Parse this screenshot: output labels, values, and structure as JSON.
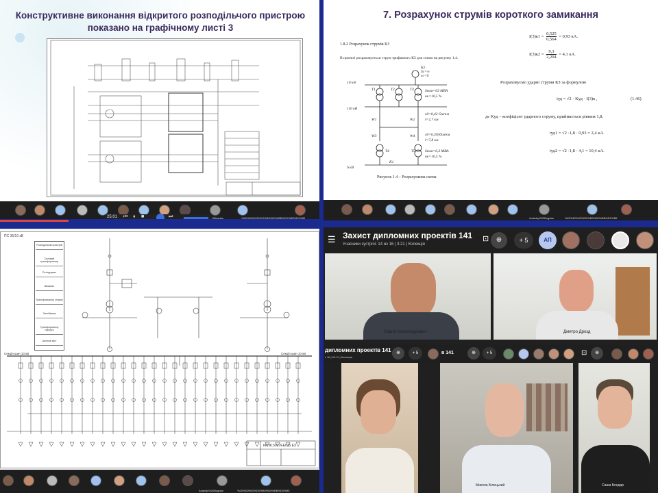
{
  "q1": {
    "title": "Конструктивне виконання відкритого розподільчого пристрою показано на графічному листі 3",
    "video_time": "25:01",
    "bar_text_1": "Anatoliy%20Bogdan",
    "bar_text_2": "%20%D0%92%D0%B0%D0%BB%D0%B5%D1%80"
  },
  "q2": {
    "title": "7. Розрахунок струмів короткого замикання",
    "section": "1.8.2 Розрахунок струмів КЗ",
    "intro": "В проекті розраховується струм трифазного КЗ для схеми на рисунку 1.4.",
    "figure_caption": "Рисунок 1.4 – Розрахункова схема",
    "f1_lhs": "I(3)к1 =",
    "f1_num": "0,525",
    "f1_den": "0,564",
    "f1_res": "= 0,93 кА.",
    "f2_lhs": "I(3)к2 =",
    "f2_num": "9,3",
    "f2_den": "2,204",
    "f2_res": "= 4,1 кА.",
    "shock_text": "Розраховуємо ударні струми КЗ за формулою",
    "shock_formula": "iуд = √2 · Kуд · I(3)к ,",
    "eq_no": "(1.46)",
    "kud_text": "де Kуд – коефіцієнт ударного струму, приймається рівним 1,8.",
    "i1": "iуд1 = √2 ·1,8 · 0,93 = 2,4 кА.",
    "i2": "iуд2 = √2 ·1,8 · 4,1 = 10,4 кА.",
    "labels": {
      "sc": "Sс=∞",
      "xc": "xс=0",
      "kv10": "10 кВ",
      "kv110": "110 кВ",
      "kv6": "6 кВ",
      "t1": "T1",
      "t2": "T2",
      "t3": "T3",
      "t4": "T4",
      "t5": "T5",
      "w1": "W1",
      "w2": "W2",
      "w3": "W3",
      "w4": "W4",
      "s1": "Sном=63 МВА",
      "u1": "uк=10,5 %",
      "x0": "x0=0,42 Ом/км",
      "l1": "l=2,7 км",
      "x02": "x0=0,393Ом/км",
      "l2": "l=7,8 км",
      "s2": "Sном=6,3 МВА",
      "u2": "uк=10,5 %",
      "k1": "K1",
      "k2": "K2"
    },
    "bar_text_1": "Anatoliy%20Bogdan",
    "bar_text_2": "%20%D0%92%D0%B0%D0%BB%D0%B5"
  },
  "q3": {
    "stamp": "КРПК.5017ЕЕ015 ЕЗ",
    "side_title": "ПС 35/10 кВ",
    "table_rows": [
      "Розподільчий пристрій",
      "Силовий трансформатор",
      "Роз'єднувач",
      "Вимикач",
      "Трансформатор струму",
      "Запобіжник",
      "Трансформатор напруги",
      "Шинний міст"
    ],
    "bus_left": "Секція шин 10 кВ",
    "bus_right": "Секція шин 10 кВ",
    "bar_text_1": "Anatoliy%20Bogdan",
    "bar_text_2": "%20%D0%92%D0%B0%D0%BB%D0%B5"
  },
  "q4": {
    "meeting_title": "Захист дипломних проектів 141",
    "meeting_sub": "Учасники зустрічі: 14 из 16 | 3:21 | Колекція",
    "plus_count": "+ 5",
    "badge": "АП",
    "names": {
      "p1": "Сергій Александрович",
      "p2": "Дмитро Дрозд",
      "p4": "Микола Білецький",
      "p5": "Саша Бондар"
    },
    "inner_title": "дипломних проектів 141",
    "inner_sub": "з 16 | 00:11 | Колекція",
    "inner_plus": "+ 5",
    "inner_right": "в 141"
  },
  "colors": {
    "accent_blue": "#1a2a8e",
    "title_dark": "#3a2a5c",
    "red_bar": "#ff2a2a"
  }
}
